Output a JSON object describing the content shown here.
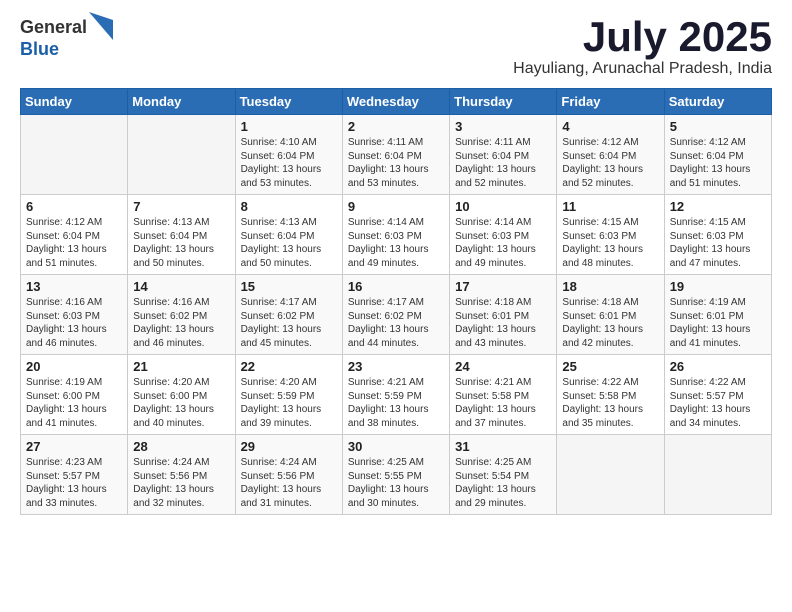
{
  "logo": {
    "general": "General",
    "blue": "Blue"
  },
  "header": {
    "month": "July 2025",
    "location": "Hayuliang, Arunachal Pradesh, India"
  },
  "weekdays": [
    "Sunday",
    "Monday",
    "Tuesday",
    "Wednesday",
    "Thursday",
    "Friday",
    "Saturday"
  ],
  "weeks": [
    [
      {
        "day": "",
        "info": ""
      },
      {
        "day": "",
        "info": ""
      },
      {
        "day": "1",
        "info": "Sunrise: 4:10 AM\nSunset: 6:04 PM\nDaylight: 13 hours and 53 minutes."
      },
      {
        "day": "2",
        "info": "Sunrise: 4:11 AM\nSunset: 6:04 PM\nDaylight: 13 hours and 53 minutes."
      },
      {
        "day": "3",
        "info": "Sunrise: 4:11 AM\nSunset: 6:04 PM\nDaylight: 13 hours and 52 minutes."
      },
      {
        "day": "4",
        "info": "Sunrise: 4:12 AM\nSunset: 6:04 PM\nDaylight: 13 hours and 52 minutes."
      },
      {
        "day": "5",
        "info": "Sunrise: 4:12 AM\nSunset: 6:04 PM\nDaylight: 13 hours and 51 minutes."
      }
    ],
    [
      {
        "day": "6",
        "info": "Sunrise: 4:12 AM\nSunset: 6:04 PM\nDaylight: 13 hours and 51 minutes."
      },
      {
        "day": "7",
        "info": "Sunrise: 4:13 AM\nSunset: 6:04 PM\nDaylight: 13 hours and 50 minutes."
      },
      {
        "day": "8",
        "info": "Sunrise: 4:13 AM\nSunset: 6:04 PM\nDaylight: 13 hours and 50 minutes."
      },
      {
        "day": "9",
        "info": "Sunrise: 4:14 AM\nSunset: 6:03 PM\nDaylight: 13 hours and 49 minutes."
      },
      {
        "day": "10",
        "info": "Sunrise: 4:14 AM\nSunset: 6:03 PM\nDaylight: 13 hours and 49 minutes."
      },
      {
        "day": "11",
        "info": "Sunrise: 4:15 AM\nSunset: 6:03 PM\nDaylight: 13 hours and 48 minutes."
      },
      {
        "day": "12",
        "info": "Sunrise: 4:15 AM\nSunset: 6:03 PM\nDaylight: 13 hours and 47 minutes."
      }
    ],
    [
      {
        "day": "13",
        "info": "Sunrise: 4:16 AM\nSunset: 6:03 PM\nDaylight: 13 hours and 46 minutes."
      },
      {
        "day": "14",
        "info": "Sunrise: 4:16 AM\nSunset: 6:02 PM\nDaylight: 13 hours and 46 minutes."
      },
      {
        "day": "15",
        "info": "Sunrise: 4:17 AM\nSunset: 6:02 PM\nDaylight: 13 hours and 45 minutes."
      },
      {
        "day": "16",
        "info": "Sunrise: 4:17 AM\nSunset: 6:02 PM\nDaylight: 13 hours and 44 minutes."
      },
      {
        "day": "17",
        "info": "Sunrise: 4:18 AM\nSunset: 6:01 PM\nDaylight: 13 hours and 43 minutes."
      },
      {
        "day": "18",
        "info": "Sunrise: 4:18 AM\nSunset: 6:01 PM\nDaylight: 13 hours and 42 minutes."
      },
      {
        "day": "19",
        "info": "Sunrise: 4:19 AM\nSunset: 6:01 PM\nDaylight: 13 hours and 41 minutes."
      }
    ],
    [
      {
        "day": "20",
        "info": "Sunrise: 4:19 AM\nSunset: 6:00 PM\nDaylight: 13 hours and 41 minutes."
      },
      {
        "day": "21",
        "info": "Sunrise: 4:20 AM\nSunset: 6:00 PM\nDaylight: 13 hours and 40 minutes."
      },
      {
        "day": "22",
        "info": "Sunrise: 4:20 AM\nSunset: 5:59 PM\nDaylight: 13 hours and 39 minutes."
      },
      {
        "day": "23",
        "info": "Sunrise: 4:21 AM\nSunset: 5:59 PM\nDaylight: 13 hours and 38 minutes."
      },
      {
        "day": "24",
        "info": "Sunrise: 4:21 AM\nSunset: 5:58 PM\nDaylight: 13 hours and 37 minutes."
      },
      {
        "day": "25",
        "info": "Sunrise: 4:22 AM\nSunset: 5:58 PM\nDaylight: 13 hours and 35 minutes."
      },
      {
        "day": "26",
        "info": "Sunrise: 4:22 AM\nSunset: 5:57 PM\nDaylight: 13 hours and 34 minutes."
      }
    ],
    [
      {
        "day": "27",
        "info": "Sunrise: 4:23 AM\nSunset: 5:57 PM\nDaylight: 13 hours and 33 minutes."
      },
      {
        "day": "28",
        "info": "Sunrise: 4:24 AM\nSunset: 5:56 PM\nDaylight: 13 hours and 32 minutes."
      },
      {
        "day": "29",
        "info": "Sunrise: 4:24 AM\nSunset: 5:56 PM\nDaylight: 13 hours and 31 minutes."
      },
      {
        "day": "30",
        "info": "Sunrise: 4:25 AM\nSunset: 5:55 PM\nDaylight: 13 hours and 30 minutes."
      },
      {
        "day": "31",
        "info": "Sunrise: 4:25 AM\nSunset: 5:54 PM\nDaylight: 13 hours and 29 minutes."
      },
      {
        "day": "",
        "info": ""
      },
      {
        "day": "",
        "info": ""
      }
    ]
  ]
}
